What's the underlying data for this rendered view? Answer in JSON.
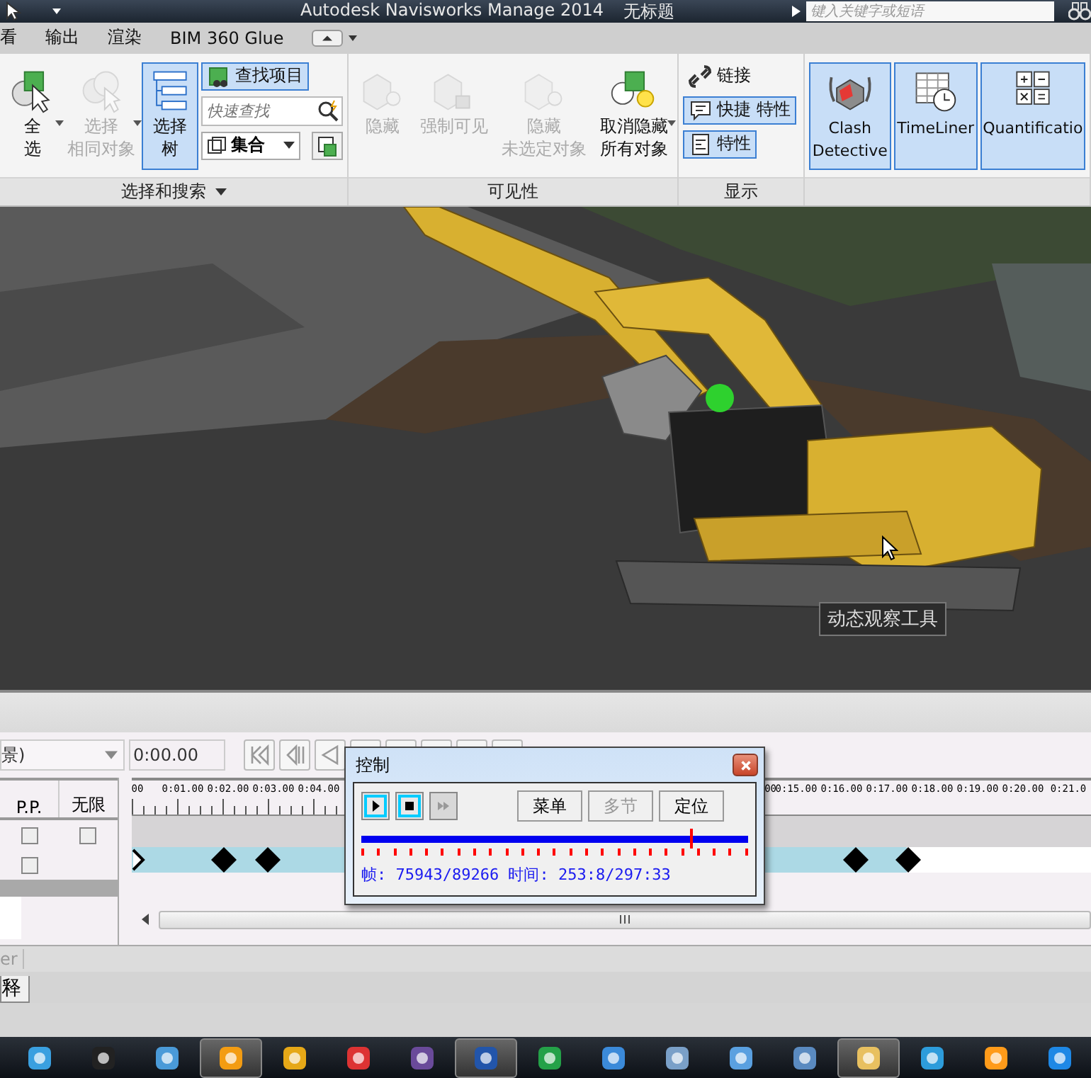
{
  "window": {
    "title": "Autodesk Navisworks Manage 2014",
    "document": "无标题",
    "search": {
      "placeholder": "键入关键字或短语"
    }
  },
  "menu_tabs": [
    {
      "label": "看"
    },
    {
      "label": "输出"
    },
    {
      "label": "渲染"
    },
    {
      "label": "BIM 360 Glue"
    }
  ],
  "ribbon": {
    "groups": [
      {
        "title": "选择和搜索",
        "has_menu": true,
        "items": [
          {
            "kind": "large",
            "lines": [
              "全",
              "选"
            ],
            "disabled": false,
            "selected": false,
            "has_menu": true
          },
          {
            "kind": "large",
            "lines": [
              "选择",
              "相同对象"
            ],
            "disabled": true,
            "selected": false,
            "has_menu": true
          },
          {
            "kind": "large",
            "lines": [
              "选择",
              "树"
            ],
            "disabled": false,
            "selected": true
          },
          {
            "kind": "column",
            "children": [
              {
                "kind": "small",
                "label": "查找项目",
                "selected": true
              },
              {
                "kind": "search",
                "placeholder": "快速查找"
              },
              {
                "kind": "combo",
                "value": "集合"
              }
            ]
          }
        ]
      },
      {
        "title": "可见性",
        "items": [
          {
            "kind": "large",
            "lines": [
              "隐藏"
            ],
            "disabled": true,
            "selected": false
          },
          {
            "kind": "large",
            "lines": [
              "强制可见"
            ],
            "disabled": true,
            "selected": false
          },
          {
            "kind": "large",
            "lines": [
              "隐藏",
              "未选定对象"
            ],
            "disabled": true,
            "selected": false
          },
          {
            "kind": "large",
            "lines": [
              "取消隐藏",
              "所有对象"
            ],
            "disabled": false,
            "selected": false,
            "has_menu": true
          }
        ]
      },
      {
        "title": "显示",
        "items": [
          {
            "kind": "column",
            "children": [
              {
                "kind": "small",
                "label": "链接",
                "selected": false
              },
              {
                "kind": "small",
                "label": "快捷 特性",
                "selected": true
              },
              {
                "kind": "small",
                "label": "特性",
                "selected": true
              }
            ]
          }
        ]
      },
      {
        "items": [
          {
            "kind": "large",
            "lines": [
              "Clash",
              "Detective"
            ],
            "disabled": false,
            "selected": true
          },
          {
            "kind": "large",
            "lines": [
              "TimeLiner"
            ],
            "disabled": false,
            "selected": true
          },
          {
            "kind": "large",
            "lines": [
              "Quantificatio"
            ],
            "disabled": false,
            "selected": true
          }
        ]
      }
    ]
  },
  "viewport": {
    "tooltip": "动态观察工具"
  },
  "timeliner": {
    "source": "景)",
    "time": "0:00.00",
    "playback": [
      {
        "kind": "first"
      },
      {
        "kind": "step_back"
      },
      {
        "kind": "play_back"
      }
    ],
    "columns": [
      "P.P.",
      "无限"
    ],
    "rows": [
      {
        "pp_checked": false,
        "infinite_checked": false
      },
      {
        "pp_checked": false
      }
    ],
    "ruler": {
      "left_labels": [
        "00",
        "0:01.00",
        "0:02.00",
        "0:03.00",
        "0:04.00"
      ],
      "right_labels": [
        "00",
        "0:15.00",
        "0:16.00",
        "0:17.00",
        "0:18.00",
        "0:19.00",
        "0:20.00",
        "0:21.0"
      ]
    },
    "status": "er",
    "tabs": [
      {
        "label": "释",
        "selected": true
      }
    ]
  },
  "control_dialog": {
    "title": "控制",
    "buttons": [
      {
        "kind": "play",
        "selected": true,
        "disabled": false
      },
      {
        "kind": "stop",
        "selected": true,
        "disabled": false
      },
      {
        "kind": "forward",
        "selected": false,
        "disabled": true
      },
      {
        "kind": "text",
        "label": "菜单",
        "selected": false,
        "disabled": false
      },
      {
        "kind": "text",
        "label": "多节",
        "selected": false,
        "disabled": true
      },
      {
        "kind": "text",
        "label": "定位",
        "selected": false,
        "disabled": false
      }
    ],
    "progress": {
      "level": 0.85
    },
    "status": "帧: 75943/89266 时间: 253:8/297:33"
  },
  "taskbar": {
    "items": [
      {
        "selected": false
      },
      {
        "selected": false
      },
      {
        "selected": false
      },
      {
        "selected": true
      },
      {
        "selected": false
      },
      {
        "selected": false
      },
      {
        "selected": false
      },
      {
        "selected": true
      },
      {
        "selected": false
      },
      {
        "selected": false
      },
      {
        "selected": false
      },
      {
        "selected": false
      },
      {
        "selected": false
      },
      {
        "selected": true
      },
      {
        "selected": false
      },
      {
        "selected": false
      },
      {
        "selected": false
      }
    ]
  }
}
